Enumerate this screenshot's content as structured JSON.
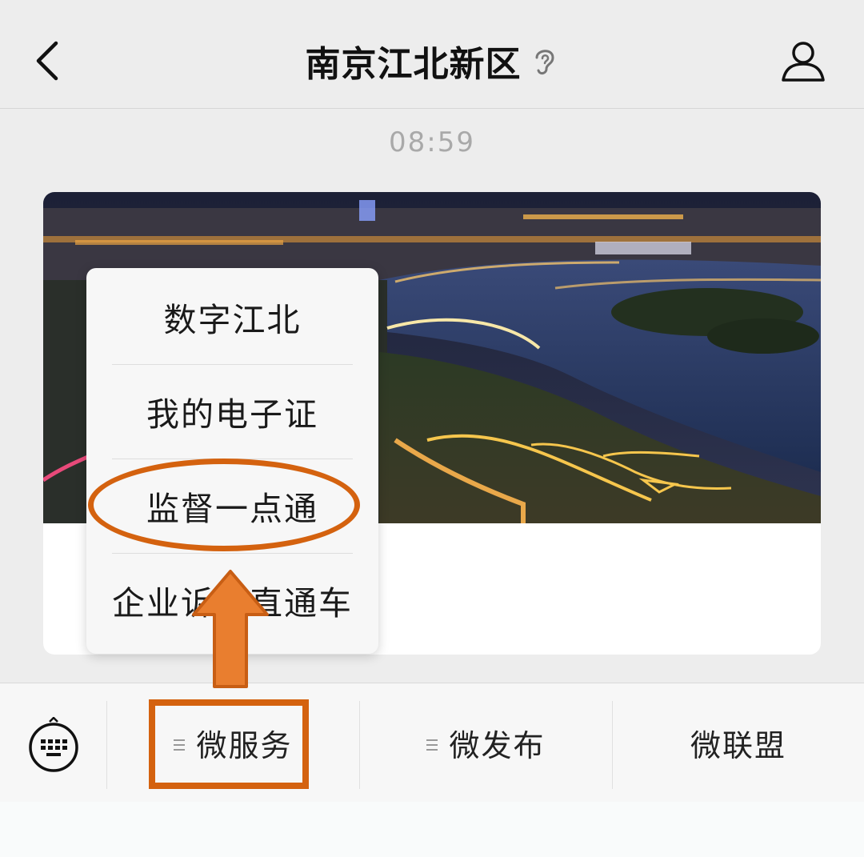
{
  "header": {
    "title": "南京江北新区",
    "back_icon": "chevron-left-icon",
    "ear_icon": "ear-icon",
    "profile_icon": "person-outline-icon"
  },
  "chat": {
    "timestamp": "08:59"
  },
  "popup_menu": {
    "items": [
      {
        "label": "数字江北"
      },
      {
        "label": "我的电子证"
      },
      {
        "label": "监督一点通"
      },
      {
        "label": "企业诉求直通车"
      }
    ]
  },
  "bottom_bar": {
    "keyboard_icon": "keyboard-icon",
    "tabs": [
      {
        "label": "微服务",
        "icon": "submenu-lines-icon"
      },
      {
        "label": "微发布",
        "icon": "submenu-lines-icon"
      },
      {
        "label": "微联盟"
      }
    ]
  },
  "colors": {
    "background": "#ededed",
    "annotation": "#d4620f",
    "arrow_fill": "#e97e2f"
  }
}
